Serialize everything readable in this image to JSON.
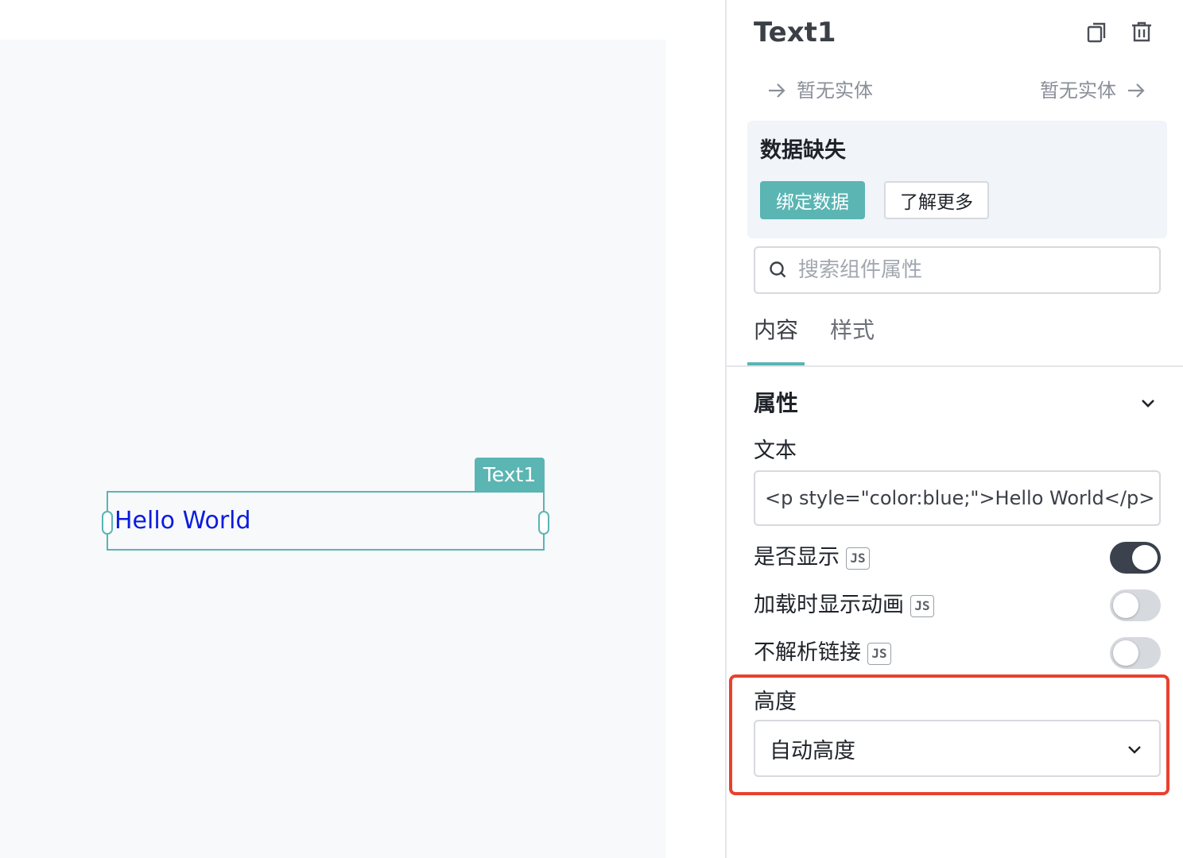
{
  "canvas": {
    "component_tag": "Text1",
    "component_text": "Hello World",
    "component_text_color": "#0a1be0"
  },
  "panel": {
    "title": "Text1",
    "icons": {
      "copy": "copy-icon",
      "delete": "trash-icon",
      "arrow": "arrow-right-icon",
      "search": "search-icon",
      "chevron": "chevron-down-icon"
    },
    "entity_left": "暂无实体",
    "entity_right": "暂无实体",
    "missing_title": "数据缺失",
    "bind_data_label": "绑定数据",
    "learn_more_label": "了解更多",
    "search_placeholder": "搜索组件属性",
    "tabs": [
      {
        "label": "内容",
        "active": true
      },
      {
        "label": "样式",
        "active": false
      }
    ],
    "section_title": "属性",
    "text_label": "文本",
    "text_value": "<p style=\"color:blue;\">Hello World</p>",
    "switches": [
      {
        "label": "是否显示",
        "badge": "JS",
        "on": true
      },
      {
        "label": "加载时显示动画",
        "badge": "JS",
        "on": false
      },
      {
        "label": "不解析链接",
        "badge": "JS",
        "on": false
      }
    ],
    "height_label": "高度",
    "height_value": "自动高度"
  },
  "colors": {
    "accent": "#5ab5b3",
    "highlight": "#e8412e",
    "switch_on": "#3b424e"
  }
}
